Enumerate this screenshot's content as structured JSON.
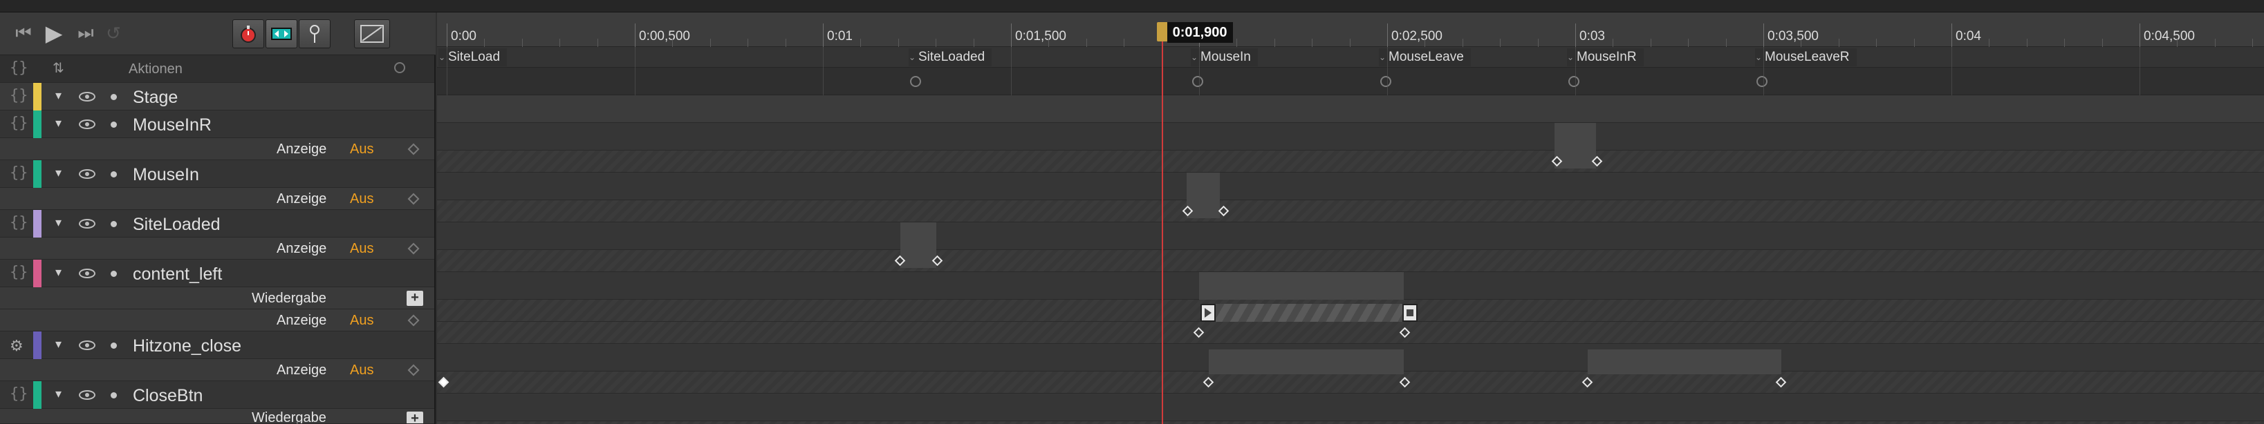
{
  "toolbar": {
    "go_start_icon": "skip-to-start-icon",
    "play_icon": "play-icon",
    "go_end_icon": "skip-to-end-icon",
    "loop_icon": "loop-icon",
    "tools": [
      "stopwatch-icon",
      "transition-icon",
      "pin-icon",
      "easing-icon"
    ]
  },
  "actions_header": {
    "label": "Aktionen"
  },
  "elements": [
    {
      "name": "Stage",
      "color": "#e8c74a",
      "properties": []
    },
    {
      "name": "MouseInR",
      "color": "#1fb38a",
      "properties": [
        {
          "label": "Anzeige",
          "value": "Aus"
        }
      ]
    },
    {
      "name": "MouseIn",
      "color": "#1fb38a",
      "properties": [
        {
          "label": "Anzeige",
          "value": "Aus"
        }
      ]
    },
    {
      "name": "SiteLoaded",
      "color": "#b09ad8",
      "properties": [
        {
          "label": "Anzeige",
          "value": "Aus"
        }
      ]
    },
    {
      "name": "content_left",
      "color": "#d75c8c",
      "properties": [
        {
          "label": "Wiedergabe",
          "value": ""
        },
        {
          "label": "Anzeige",
          "value": "Aus"
        }
      ]
    },
    {
      "name": "Hitzone_close",
      "color": "#6a5fb8",
      "properties": [
        {
          "label": "Anzeige",
          "value": "Aus"
        }
      ]
    },
    {
      "name": "CloseBtn",
      "color": "#1fb38a",
      "properties": [
        {
          "label": "Wiedergabe",
          "value": ""
        }
      ]
    }
  ],
  "ruler": {
    "ticks": [
      "0:00",
      "0:00,500",
      "0:01",
      "0:01,500",
      "0:02",
      "0:02,500",
      "0:03",
      "0:03,500",
      "0:04",
      "0:04,500"
    ]
  },
  "playhead": {
    "time": "0:01,900",
    "seconds": 1.9
  },
  "labels": [
    {
      "name": "SiteLoad",
      "time": 0.0
    },
    {
      "name": "SiteLoaded",
      "time": 1.25
    },
    {
      "name": "MouseIn",
      "time": 2.0
    },
    {
      "name": "MouseLeave",
      "time": 2.5
    },
    {
      "name": "MouseInR",
      "time": 3.0
    },
    {
      "name": "MouseLeaveR",
      "time": 3.5
    }
  ],
  "colors": {
    "accent": "#f0a020",
    "playhead": "#d23b3b"
  }
}
